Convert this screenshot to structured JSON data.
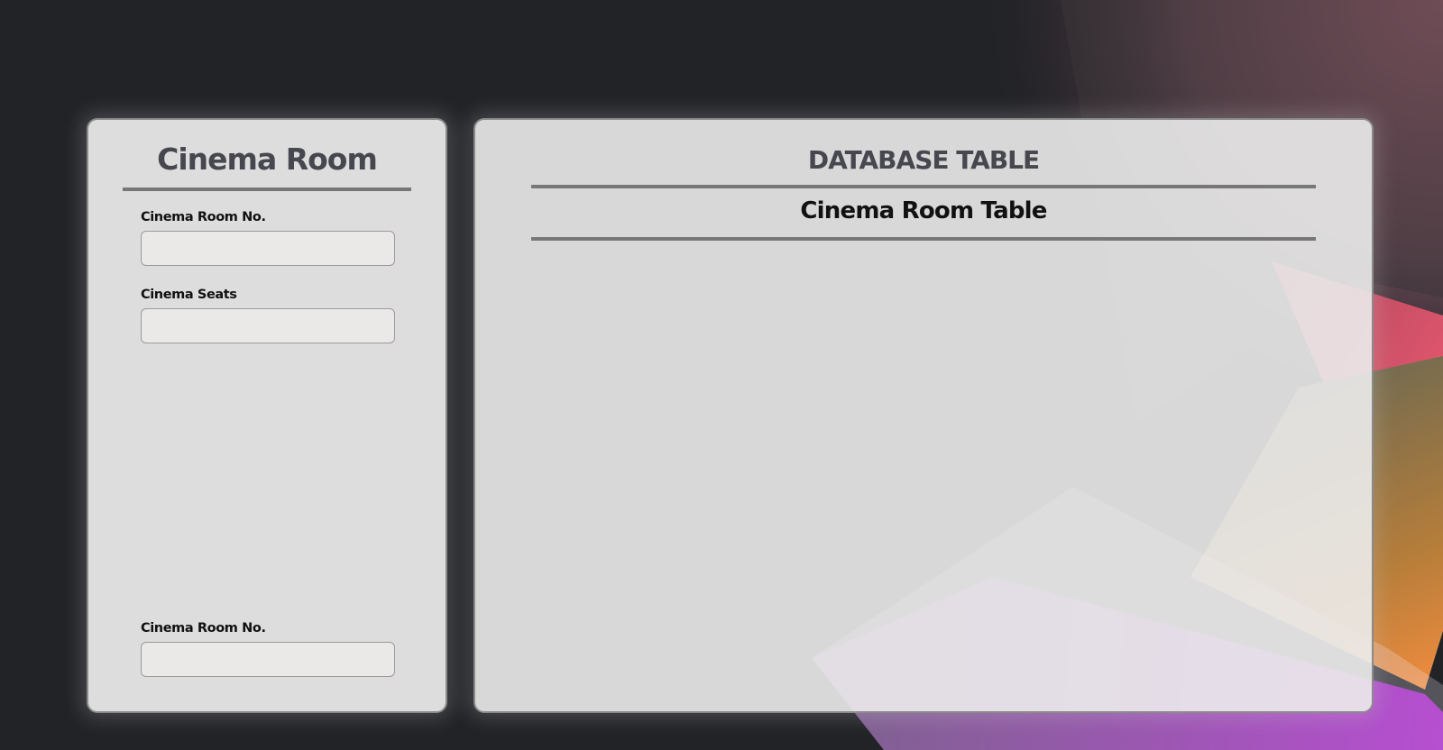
{
  "colors": {
    "page_background": "#222327",
    "panel_background": "#ececec",
    "heading": "#46474f",
    "text": "#111111",
    "rule": "#777777",
    "accent_pink": "#d6506a",
    "accent_orange": "#e8903a",
    "accent_purple": "#9b1fb5"
  },
  "cinema_room_form": {
    "title": "Cinema Room",
    "room_no": {
      "label": "Cinema Room No.",
      "value": "",
      "placeholder": ""
    },
    "seats": {
      "label": "Cinema Seats",
      "value": "",
      "placeholder": ""
    },
    "lookup_room_no": {
      "label": "Cinema Room No.",
      "value": "",
      "placeholder": ""
    }
  },
  "database_panel": {
    "title": "DATABASE TABLE",
    "table_title": "Cinema Room Table"
  }
}
